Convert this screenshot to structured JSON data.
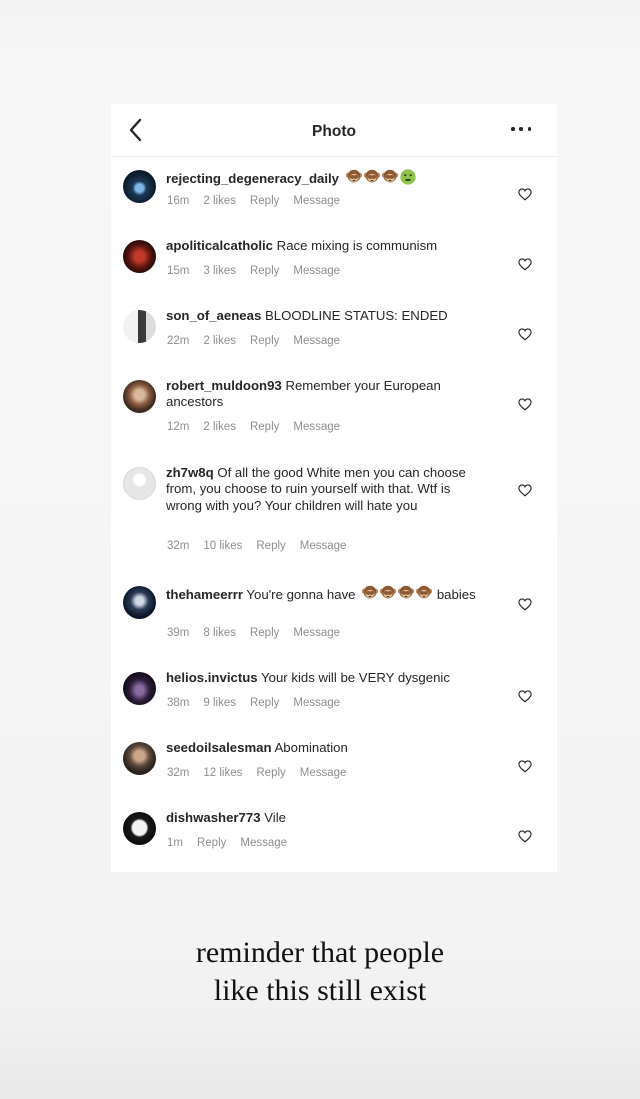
{
  "header": {
    "title": "Photo"
  },
  "comments": [
    {
      "username": "rejecting_degeneracy_daily",
      "text": "",
      "emoji": [
        "monkey",
        "monkey",
        "monkey",
        "nauseated-face"
      ],
      "time": "16m",
      "likes": "2 likes",
      "reply": "Reply",
      "message": "Message"
    },
    {
      "username": "apoliticalcatholic",
      "text": "Race mixing is communism",
      "time": "15m",
      "likes": "3 likes",
      "reply": "Reply",
      "message": "Message"
    },
    {
      "username": "son_of_aeneas",
      "text": "BLOODLINE STATUS: ENDED",
      "time": "22m",
      "likes": "2 likes",
      "reply": "Reply",
      "message": "Message"
    },
    {
      "username": "robert_muldoon93",
      "text": "Remember your European ancestors",
      "time": "12m",
      "likes": "2 likes",
      "reply": "Reply",
      "message": "Message"
    },
    {
      "username": "zh7w8q",
      "text": "Of all the good White men you can choose from, you choose to ruin yourself with that. Wtf is wrong with you? Your children will hate you",
      "time": "32m",
      "likes": "10 likes",
      "reply": "Reply",
      "message": "Message"
    },
    {
      "username": "thehameerrr",
      "text": "You're gonna have",
      "text_after": "babies",
      "emoji": [
        "monkey",
        "monkey",
        "monkey",
        "monkey"
      ],
      "time": "39m",
      "likes": "8 likes",
      "reply": "Reply",
      "message": "Message"
    },
    {
      "username": "helios.invictus",
      "text": "Your kids will be VERY dysgenic",
      "time": "38m",
      "likes": "9 likes",
      "reply": "Reply",
      "message": "Message"
    },
    {
      "username": "seedoilsalesman",
      "text": "Abomination",
      "time": "32m",
      "likes": "12 likes",
      "reply": "Reply",
      "message": "Message"
    },
    {
      "username": "dishwasher773",
      "text": "Vile",
      "time": "1m",
      "likes": "",
      "reply": "Reply",
      "message": "Message"
    }
  ],
  "caption": {
    "line1": "reminder that people",
    "line2": "like this still exist"
  },
  "colors": {
    "username": "#262626",
    "meta": "#8e8e8e",
    "background": "#f4f4f4",
    "card": "#ffffff"
  }
}
